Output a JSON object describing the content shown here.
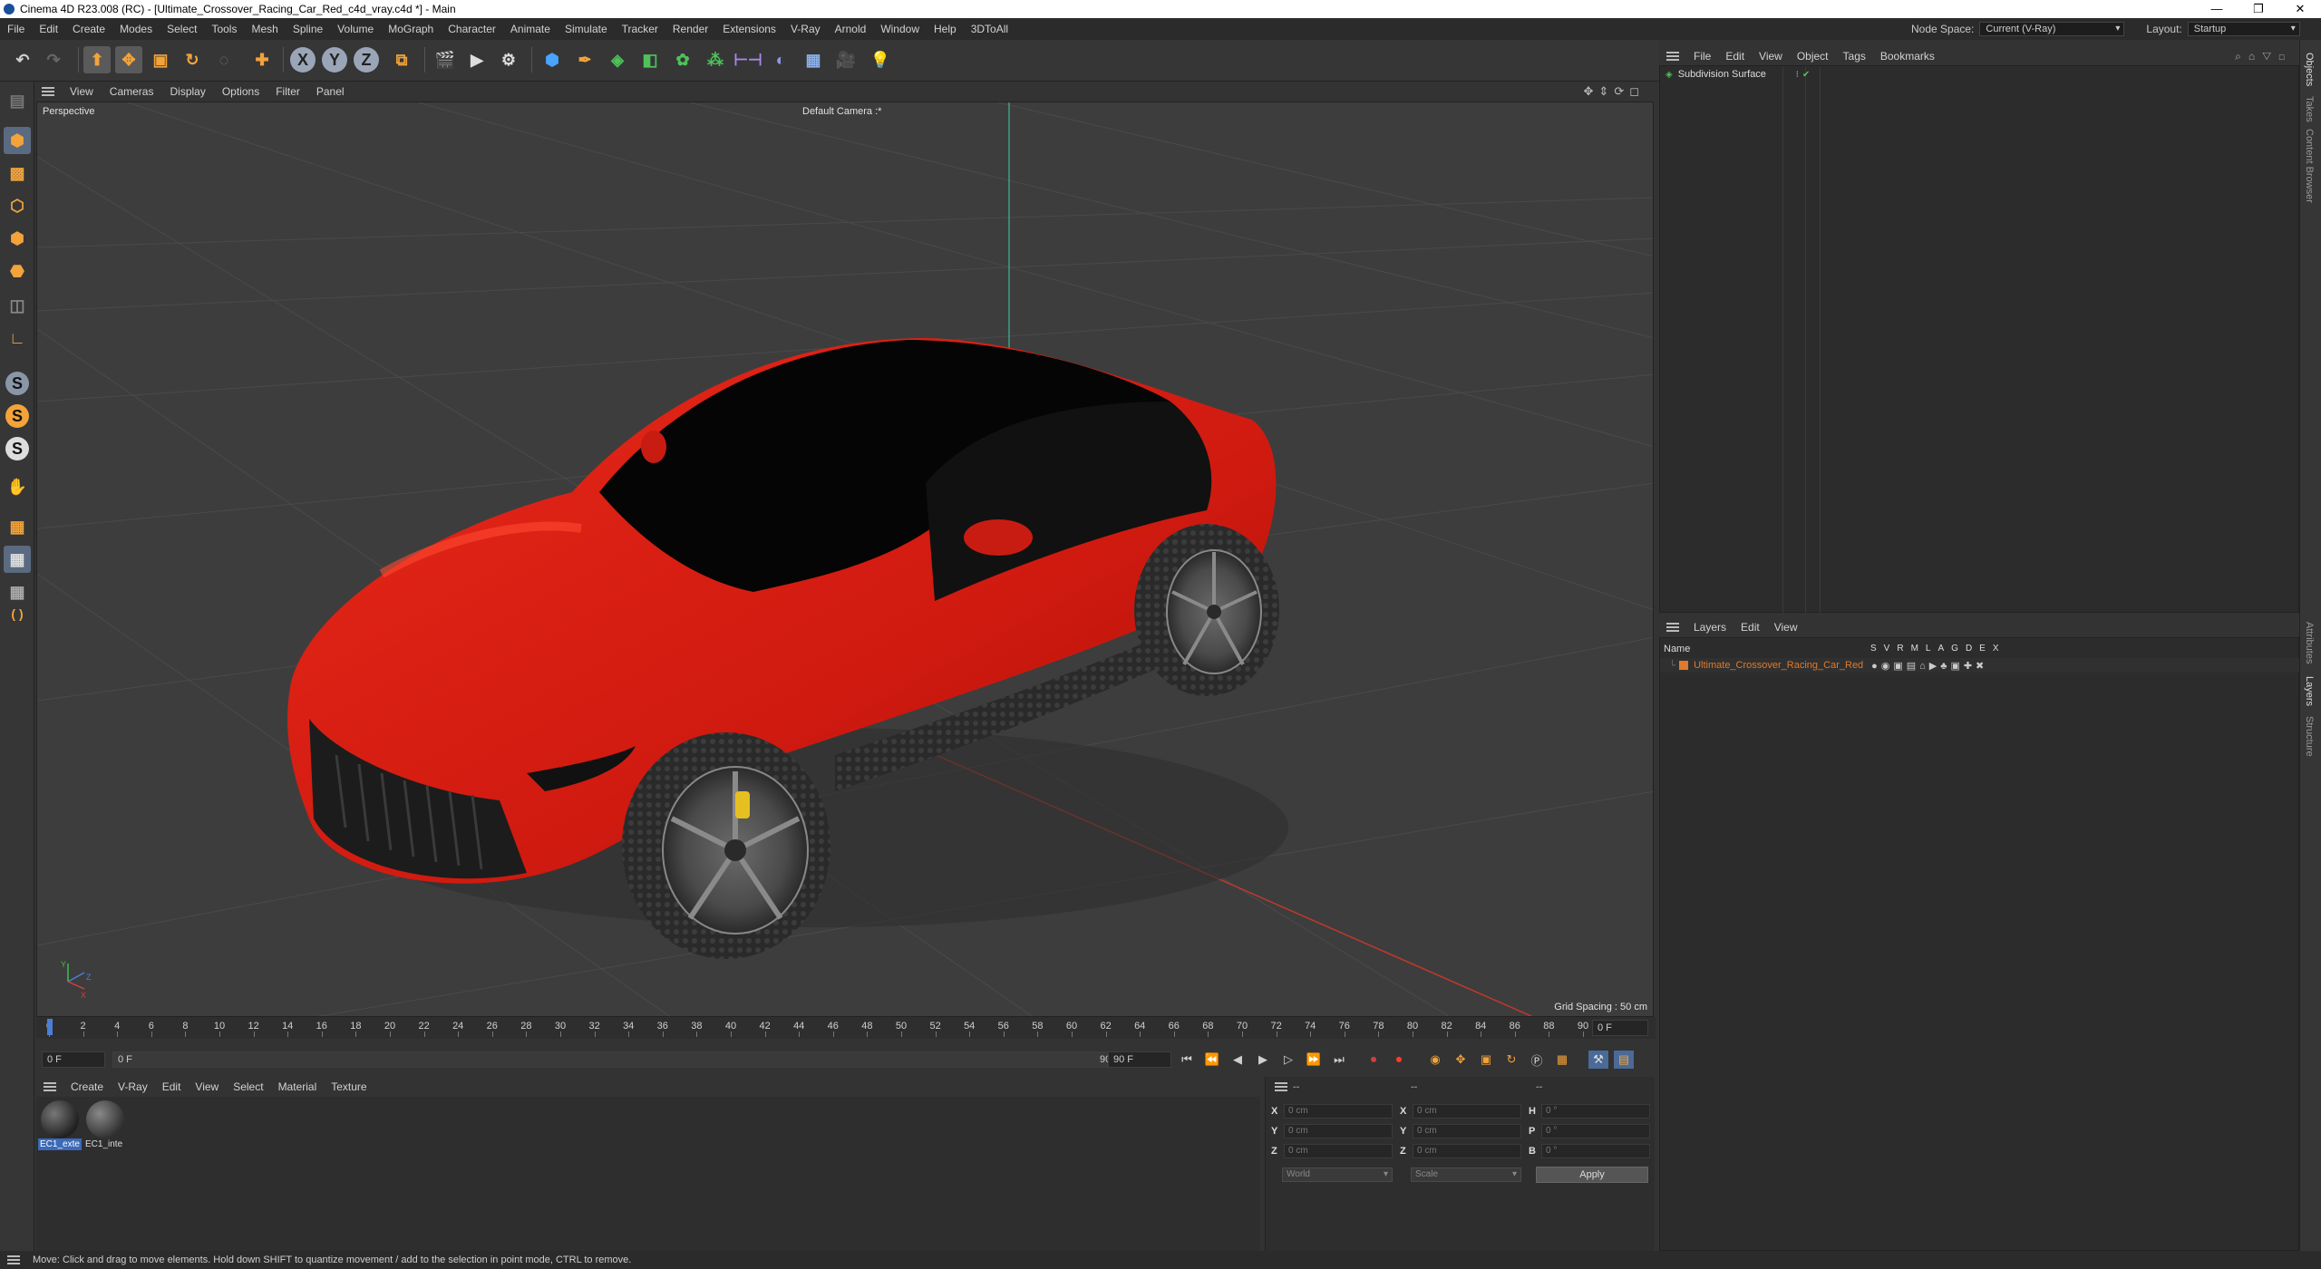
{
  "window": {
    "title": "Cinema 4D R23.008 (RC) - [Ultimate_Crossover_Racing_Car_Red_c4d_vray.c4d *] - Main",
    "controls": [
      "—",
      "❐",
      "✕"
    ]
  },
  "menubar": {
    "items": [
      "File",
      "Edit",
      "Create",
      "Modes",
      "Select",
      "Tools",
      "Mesh",
      "Spline",
      "Volume",
      "MoGraph",
      "Character",
      "Animate",
      "Simulate",
      "Tracker",
      "Render",
      "Extensions",
      "V-Ray",
      "Arnold",
      "Window",
      "Help",
      "3DToAll"
    ],
    "node_space_label": "Node Space:",
    "node_space_value": "Current (V-Ray)",
    "layout_label": "Layout:",
    "layout_value": "Startup"
  },
  "toolbar": {
    "axis_x": "X",
    "axis_y": "Y",
    "axis_z": "Z"
  },
  "leftbar": {
    "s1": "S",
    "s2": "S",
    "s3": "S"
  },
  "viewport": {
    "menu": [
      "View",
      "Cameras",
      "Display",
      "Options",
      "Filter",
      "Panel"
    ],
    "projection": "Perspective",
    "camera": "Default Camera :*",
    "grid_spacing": "Grid Spacing : 50 cm",
    "axis_labels": {
      "y": "Y",
      "x": "X",
      "z": "Z"
    }
  },
  "timeline": {
    "ticks": [
      "0",
      "2",
      "4",
      "6",
      "8",
      "10",
      "12",
      "14",
      "16",
      "18",
      "20",
      "22",
      "24",
      "26",
      "28",
      "30",
      "32",
      "34",
      "36",
      "38",
      "40",
      "42",
      "44",
      "46",
      "48",
      "50",
      "52",
      "54",
      "56",
      "58",
      "60",
      "62",
      "64",
      "66",
      "68",
      "70",
      "72",
      "74",
      "76",
      "78",
      "80",
      "82",
      "84",
      "86",
      "88",
      "90"
    ],
    "current_frame_field": "0 F",
    "start": "0 F",
    "range_start": "0 F",
    "range_end": "90 F",
    "end": "90 F"
  },
  "material_manager": {
    "menu": [
      "Create",
      "V-Ray",
      "Edit",
      "View",
      "Select",
      "Material",
      "Texture"
    ],
    "materials": [
      {
        "name": "EC1_exte",
        "selected": true
      },
      {
        "name": "EC1_inte",
        "selected": false
      }
    ]
  },
  "coordinates": {
    "header1": "--",
    "header2": "--",
    "header3": "--",
    "rows": [
      {
        "a": "X",
        "av": "0 cm",
        "b": "X",
        "bv": "0 cm",
        "c": "H",
        "cv": "0 °"
      },
      {
        "a": "Y",
        "av": "0 cm",
        "b": "Y",
        "bv": "0 cm",
        "c": "P",
        "cv": "0 °"
      },
      {
        "a": "Z",
        "av": "0 cm",
        "b": "Z",
        "bv": "0 cm",
        "c": "B",
        "cv": "0 °"
      }
    ],
    "space": "World",
    "mode": "Scale",
    "apply": "Apply"
  },
  "object_manager": {
    "menu": [
      "File",
      "Edit",
      "View",
      "Object",
      "Tags",
      "Bookmarks"
    ],
    "objects": [
      {
        "name": "Subdivision Surface"
      }
    ]
  },
  "layer_manager": {
    "menu": [
      "Layers",
      "Edit",
      "View"
    ],
    "name_header": "Name",
    "flags": [
      "S",
      "V",
      "R",
      "M",
      "L",
      "A",
      "G",
      "D",
      "E",
      "X"
    ],
    "layers": [
      {
        "name": "Ultimate_Crossover_Racing_Car_Red",
        "color": "#e07a2a"
      }
    ]
  },
  "right_tabs": {
    "top": [
      "Objects",
      "Takes",
      "Content Browser"
    ],
    "bottom": [
      "Attributes",
      "Layers",
      "Structure"
    ]
  },
  "statusbar": {
    "text": "Move: Click and drag to move elements. Hold down SHIFT to quantize movement / add to the selection in point mode, CTRL to remove."
  },
  "colors": {
    "car_body": "#d81c10",
    "accent_blue": "#4aa3ff",
    "orange": "#e07a2a"
  }
}
